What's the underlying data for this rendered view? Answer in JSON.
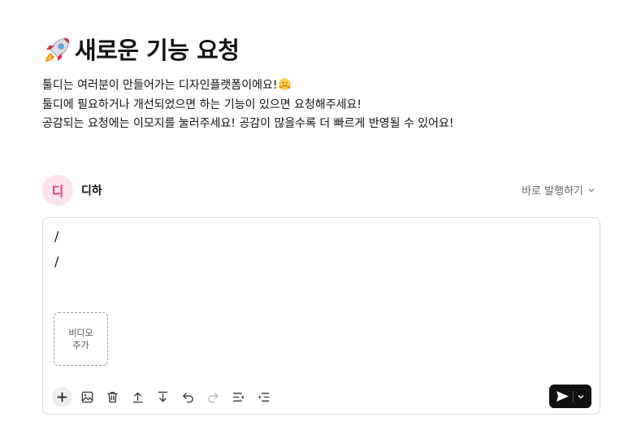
{
  "page": {
    "title": "새로운 기능 요청",
    "description": [
      "툴디는 여러분이 만들어가는 디자인플랫폼이에요!",
      "툴디에 필요하거나 개선되었으면 하는 기능이 있으면 요청해주세요!",
      "공감되는 요청에는 이모지를 눌러주세요! 공감이 많을수록 더 빠르게 반영될 수 있어요!"
    ]
  },
  "author": {
    "avatar_text": "디",
    "name": "디하"
  },
  "publish": {
    "label": "바로 발행하기"
  },
  "editor": {
    "lines": [
      "/",
      "/"
    ],
    "video_add": {
      "line1": "비디오",
      "line2": "추가"
    }
  },
  "icons": {
    "title_emoji": "rocket",
    "description_emoji": "hugging-face",
    "toolbar": [
      "plus",
      "image",
      "trash",
      "move-up",
      "move-down",
      "undo",
      "redo",
      "outdent",
      "indent"
    ],
    "send": "send",
    "send_dropdown": "chevron-down"
  },
  "colors": {
    "avatar_bg": "#fde4ec",
    "avatar_text": "#e4407a",
    "send_button_bg": "#111111"
  }
}
